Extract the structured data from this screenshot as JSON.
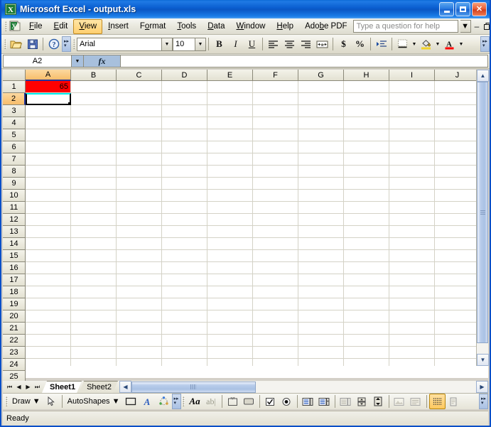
{
  "window": {
    "title": "Microsoft Excel - output.xls",
    "app_icon": "excel-icon",
    "minimize": "_",
    "maximize": "□",
    "close": "✕"
  },
  "menubar": {
    "items": [
      {
        "label": "File",
        "accel": "F",
        "active": false
      },
      {
        "label": "Edit",
        "accel": "E",
        "active": false
      },
      {
        "label": "View",
        "accel": "V",
        "active": true
      },
      {
        "label": "Insert",
        "accel": "I",
        "active": false
      },
      {
        "label": "Format",
        "accel": "o",
        "active": false
      },
      {
        "label": "Tools",
        "accel": "T",
        "active": false
      },
      {
        "label": "Data",
        "accel": "D",
        "active": false
      },
      {
        "label": "Window",
        "accel": "W",
        "active": false
      },
      {
        "label": "Help",
        "accel": "H",
        "active": false
      },
      {
        "label": "Adobe PDF",
        "accel": "b",
        "active": false
      }
    ],
    "ask_placeholder": "Type a question for help",
    "ask_value": "",
    "doc_minimize": "–",
    "doc_restore": "❐",
    "doc_close": "✕"
  },
  "standard_toolbar": {
    "buttons": [
      {
        "name": "open-icon",
        "title": "Open"
      },
      {
        "name": "save-icon",
        "title": "Save"
      },
      {
        "name": "help-icon",
        "title": "Microsoft Excel Help"
      }
    ],
    "overflow": "Toolbar Options"
  },
  "formatting_toolbar": {
    "font_name": "Arial",
    "font_size": "10",
    "bold": "B",
    "italic": "I",
    "underline": "U",
    "align_left": "align-left-icon",
    "align_center": "align-center-icon",
    "align_right": "align-right-icon",
    "merge_center": "merge-center-icon",
    "currency": "$",
    "percent": "%",
    "indent": "increase-indent-icon",
    "borders": "borders-icon",
    "fill_color": "fill-color-icon",
    "font_color": "font-color-icon",
    "font_color_swatch": "#FF0000",
    "overflow": "Toolbar Options"
  },
  "formula_bar": {
    "name_box": "A2",
    "fx_label": "fx",
    "formula_value": ""
  },
  "sheet": {
    "columns": [
      "A",
      "B",
      "C",
      "D",
      "E",
      "F",
      "G",
      "H",
      "I",
      "J"
    ],
    "selected_column": "A",
    "rows": [
      1,
      2,
      3,
      4,
      5,
      6,
      7,
      8,
      9,
      10,
      11,
      12,
      13,
      14,
      15,
      16,
      17,
      18,
      19,
      20,
      21,
      22,
      23,
      24,
      25
    ],
    "selected_row": 2,
    "active_cell": "A2",
    "cells": [
      {
        "ref": "A1",
        "row": 1,
        "col": "A",
        "value": "65",
        "fill": "#FF0000",
        "align": "right"
      }
    ],
    "tabs": [
      {
        "label": "Sheet1",
        "active": true
      },
      {
        "label": "Sheet2",
        "active": false
      }
    ],
    "tab_nav": [
      "◀│",
      "◀",
      "▶",
      "│▶"
    ]
  },
  "drawing_toolbar": {
    "draw_label": "Draw",
    "autoshapes_label": "AutoShapes",
    "select_icon": "select-arrow-icon",
    "rectangle_icon": "rectangle-icon",
    "wordart_icon": "wordart-icon",
    "diagram_icon": "diagram-icon"
  },
  "control_toolbox": {
    "label_icon": "label-icon",
    "textbox_icon": "textbox-icon",
    "frame_icon": "frame-icon",
    "button_icon": "button-icon",
    "checkbox_icon": "checkbox-icon",
    "option_icon": "option-button-icon",
    "listbox_icon": "list-box-icon",
    "combobox_icon": "combo-box-icon",
    "togglebutton_icon": "toggle-button-icon",
    "spinbutton_icon": "spin-button-icon",
    "scrollbar_icon": "scroll-bar-icon",
    "image_icon": "image-icon",
    "moreconrols_icon": "more-controls-icon",
    "design_mode_icon": "design-mode-icon",
    "properties_icon": "properties-icon",
    "viewcode_icon": "view-code-icon"
  },
  "statusbar": {
    "text": "Ready"
  },
  "colors": {
    "title_blue": "#0a57c4",
    "cell_red": "#FF0000",
    "header_selected": "#f7bd6b",
    "selection_border": "#000000",
    "selection_top": "#00e8e8"
  }
}
